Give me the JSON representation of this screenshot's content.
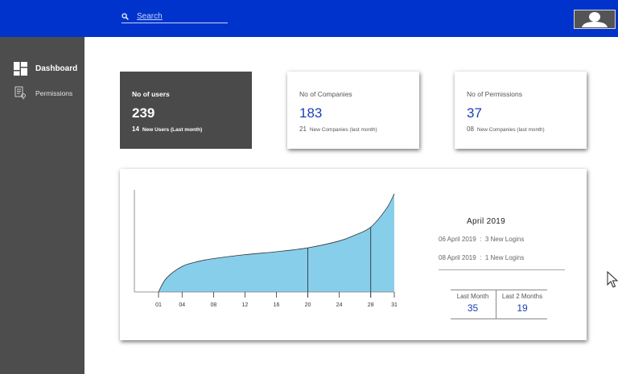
{
  "header": {
    "search_placeholder": "Search",
    "icons": {
      "search": "search-icon",
      "avatar": "user-avatar-icon"
    }
  },
  "sidebar": {
    "items": [
      {
        "label": "Dashboard",
        "icon": "dashboard-icon",
        "active": true
      },
      {
        "label": "Permissions",
        "icon": "permissions-icon",
        "active": false
      }
    ]
  },
  "cards": {
    "users": {
      "title": "No of users",
      "value": "239",
      "sub_count": "14",
      "sub_label": "New Users (Last month)"
    },
    "companies": {
      "title": "No of Companies",
      "value": "183",
      "sub_count": "21",
      "sub_label": "New Companies (last month)"
    },
    "permissions": {
      "title": "No of Permissions",
      "value": "37",
      "sub_count": "08",
      "sub_label": "New Companies (last month)"
    }
  },
  "detail": {
    "title": "April 2019",
    "logins": [
      {
        "date": "06 April 2019",
        "sep": ":",
        "text": "3 New Logins"
      },
      {
        "date": "08 April 2019",
        "sep": ":",
        "text": "1 New Logins"
      }
    ],
    "stats": [
      {
        "label": "Last Month",
        "value": "35"
      },
      {
        "label": "Last 2 Months",
        "value": "19"
      }
    ]
  },
  "colors": {
    "topbar": "#0033cc",
    "sidebar": "#4d4d4d",
    "accent_blue": "#1a3fb5",
    "area_fill": "#87ceeb"
  },
  "chart_data": {
    "type": "area",
    "title": "",
    "xlabel": "",
    "ylabel": "",
    "x_ticks": [
      "01",
      "04",
      "08",
      "12",
      "16",
      "20",
      "24",
      "28",
      "31"
    ],
    "x": [
      1,
      2,
      4,
      6,
      8,
      12,
      16,
      20,
      24,
      26,
      28,
      30,
      31
    ],
    "values": [
      0,
      14,
      26,
      31,
      34,
      38,
      41,
      45,
      52,
      58,
      66,
      85,
      100
    ],
    "markers": [
      20,
      28
    ],
    "xlim": [
      1,
      31
    ],
    "ylim": [
      0,
      100
    ],
    "grid": false
  }
}
